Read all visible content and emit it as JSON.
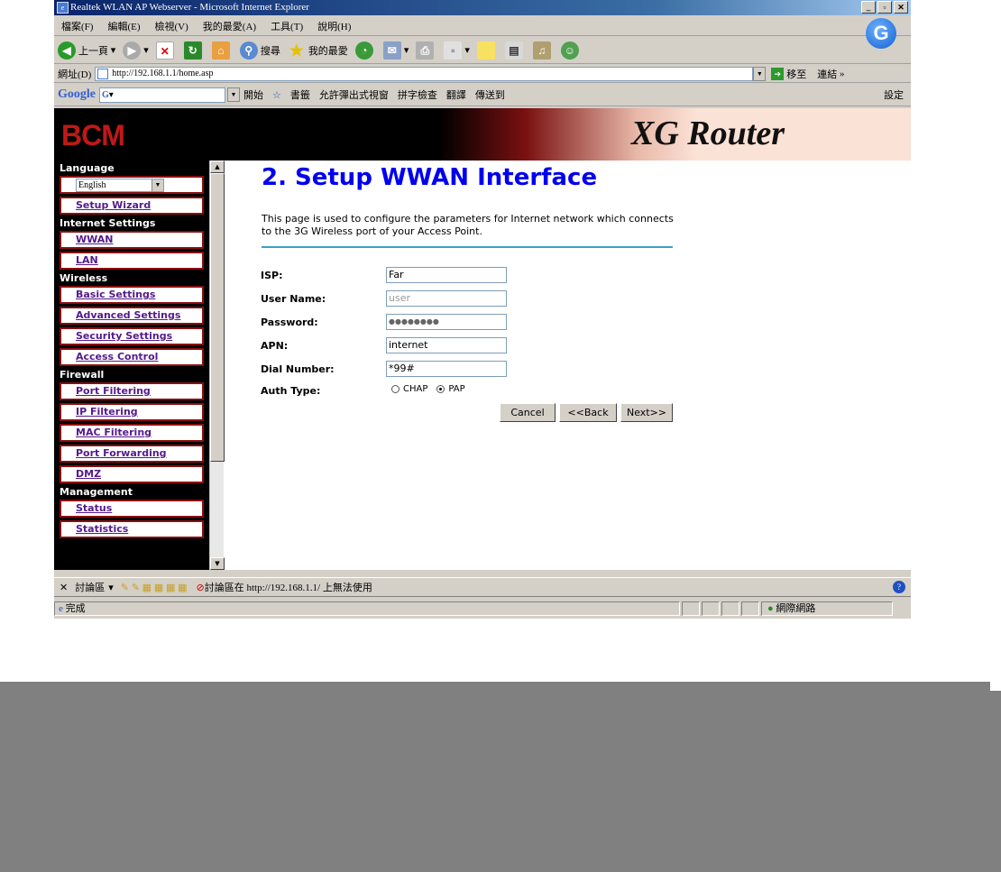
{
  "window": {
    "title": "Realtek WLAN AP Webserver - Microsoft Internet Explorer",
    "min": "_",
    "max": "▫",
    "close": "✕"
  },
  "menu": [
    "檔案(F)",
    "編輯(E)",
    "檢視(V)",
    "我的最愛(A)",
    "工具(T)",
    "說明(H)"
  ],
  "toolbar": {
    "back": "上一頁",
    "search": "搜尋",
    "favorites": "我的最愛"
  },
  "address": {
    "label": "網址(D)",
    "url": "http://192.168.1.1/home.asp",
    "go": "移至",
    "links": "連結"
  },
  "googlebar": {
    "logo": "Google",
    "search_prefix": "G",
    "start": "開始",
    "bookmarks": "書籤",
    "popups": "允許彈出式視窗",
    "spell": "拼字檢查",
    "translate": "翻譯",
    "send": "傳送到",
    "settings": "設定"
  },
  "banner": {
    "logo": "BCM",
    "product": "XG Router"
  },
  "sidebar": {
    "language_label": "Language",
    "language_value": "English",
    "setup_wizard": "Setup Wizard",
    "internet_label": "Internet Settings",
    "wwan": "WWAN",
    "lan": "LAN",
    "wireless_label": "Wireless",
    "basic": "Basic Settings",
    "advanced": "Advanced Settings",
    "security": "Security Settings",
    "access": "Access Control",
    "firewall_label": "Firewall",
    "port_filtering": "Port Filtering",
    "ip_filtering": "IP Filtering",
    "mac_filtering": "MAC Filtering",
    "port_forwarding": "Port Forwarding",
    "dmz": "DMZ",
    "management_label": "Management",
    "status": "Status",
    "statistics": "Statistics"
  },
  "main": {
    "title": "2. Setup WWAN Interface",
    "description": "This page is used to configure the parameters for Internet network which connects to the 3G Wireless port of your Access Point.",
    "isp_label": "ISP:",
    "isp_value": "Far",
    "user_label": "User Name:",
    "user_placeholder": "user",
    "pass_label": "Password:",
    "pass_value": "●●●●●●●●",
    "apn_label": "APN:",
    "apn_value": "internet",
    "dial_label": "Dial Number:",
    "dial_value": "*99#",
    "auth_label": "Auth Type:",
    "auth_chap": "CHAP",
    "auth_pap": "PAP",
    "auth_selected": "PAP",
    "cancel": "Cancel",
    "back": "<<Back",
    "next": "Next>>"
  },
  "discussbar": {
    "label": "討論區",
    "status": "討論區在 http://192.168.1.1/ 上無法使用"
  },
  "statusbar": {
    "done": "完成",
    "zone": "網際網路"
  }
}
